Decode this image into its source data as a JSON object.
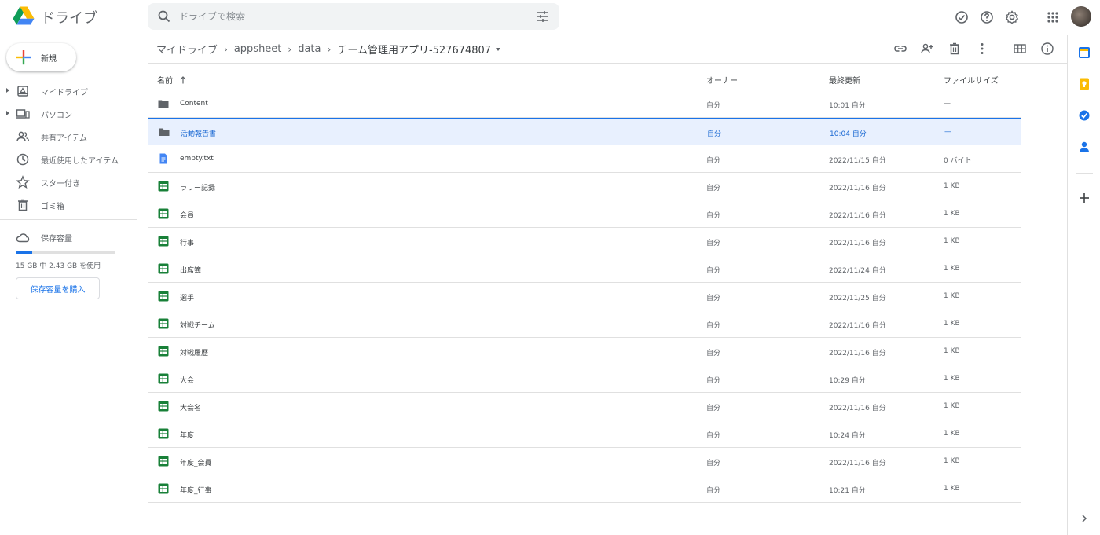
{
  "app": {
    "title": "ドライブ"
  },
  "search": {
    "placeholder": "ドライブで検索"
  },
  "sidebar": {
    "new_label": "新規",
    "items": [
      {
        "label": "マイドライブ",
        "icon": "my-drive-icon"
      },
      {
        "label": "パソコン",
        "icon": "computers-icon"
      },
      {
        "label": "共有アイテム",
        "icon": "shared-icon"
      },
      {
        "label": "最近使用したアイテム",
        "icon": "clock-icon"
      },
      {
        "label": "スター付き",
        "icon": "star-icon"
      },
      {
        "label": "ゴミ箱",
        "icon": "trash-icon"
      }
    ],
    "storage": {
      "label": "保存容量",
      "usage_text": "15 GB 中 2.43 GB を使用",
      "used_fraction": 0.162,
      "buy_label": "保存容量を購入"
    }
  },
  "breadcrumb": {
    "items": [
      "マイドライブ",
      "appsheet",
      "data"
    ],
    "current": "チーム管理用アプリ-527674807"
  },
  "table": {
    "headers": {
      "name": "名前",
      "owner": "オーナー",
      "modified": "最終更新",
      "size": "ファイルサイズ"
    },
    "rows": [
      {
        "type": "folder",
        "name": "Content",
        "owner": "自分",
        "modified": "10:01 自分",
        "size": "—"
      },
      {
        "type": "folder",
        "name": "活動報告書",
        "owner": "自分",
        "modified": "10:04 自分",
        "size": "—",
        "selected": true
      },
      {
        "type": "doc",
        "name": "empty.txt",
        "owner": "自分",
        "modified": "2022/11/15 自分",
        "size": "0 バイト"
      },
      {
        "type": "sheet",
        "name": "ラリー記録",
        "owner": "自分",
        "modified": "2022/11/16 自分",
        "size": "1 KB"
      },
      {
        "type": "sheet",
        "name": "会員",
        "owner": "自分",
        "modified": "2022/11/16 自分",
        "size": "1 KB"
      },
      {
        "type": "sheet",
        "name": "行事",
        "owner": "自分",
        "modified": "2022/11/16 自分",
        "size": "1 KB"
      },
      {
        "type": "sheet",
        "name": "出席簿",
        "owner": "自分",
        "modified": "2022/11/24 自分",
        "size": "1 KB"
      },
      {
        "type": "sheet",
        "name": "選手",
        "owner": "自分",
        "modified": "2022/11/25 自分",
        "size": "1 KB"
      },
      {
        "type": "sheet",
        "name": "対戦チーム",
        "owner": "自分",
        "modified": "2022/11/16 自分",
        "size": "1 KB"
      },
      {
        "type": "sheet",
        "name": "対戦履歴",
        "owner": "自分",
        "modified": "2022/11/16 自分",
        "size": "1 KB"
      },
      {
        "type": "sheet",
        "name": "大会",
        "owner": "自分",
        "modified": "10:29 自分",
        "size": "1 KB"
      },
      {
        "type": "sheet",
        "name": "大会名",
        "owner": "自分",
        "modified": "2022/11/16 自分",
        "size": "1 KB"
      },
      {
        "type": "sheet",
        "name": "年度",
        "owner": "自分",
        "modified": "10:24 自分",
        "size": "1 KB"
      },
      {
        "type": "sheet",
        "name": "年度_会員",
        "owner": "自分",
        "modified": "2022/11/16 自分",
        "size": "1 KB"
      },
      {
        "type": "sheet",
        "name": "年度_行事",
        "owner": "自分",
        "modified": "10:21 自分",
        "size": "1 KB"
      }
    ]
  },
  "colors": {
    "accent": "#1a73e8",
    "sheet_green": "#188038",
    "doc_blue": "#4285f4",
    "folder_grey": "#5f6368",
    "selected_bg": "#e8f0fe"
  }
}
